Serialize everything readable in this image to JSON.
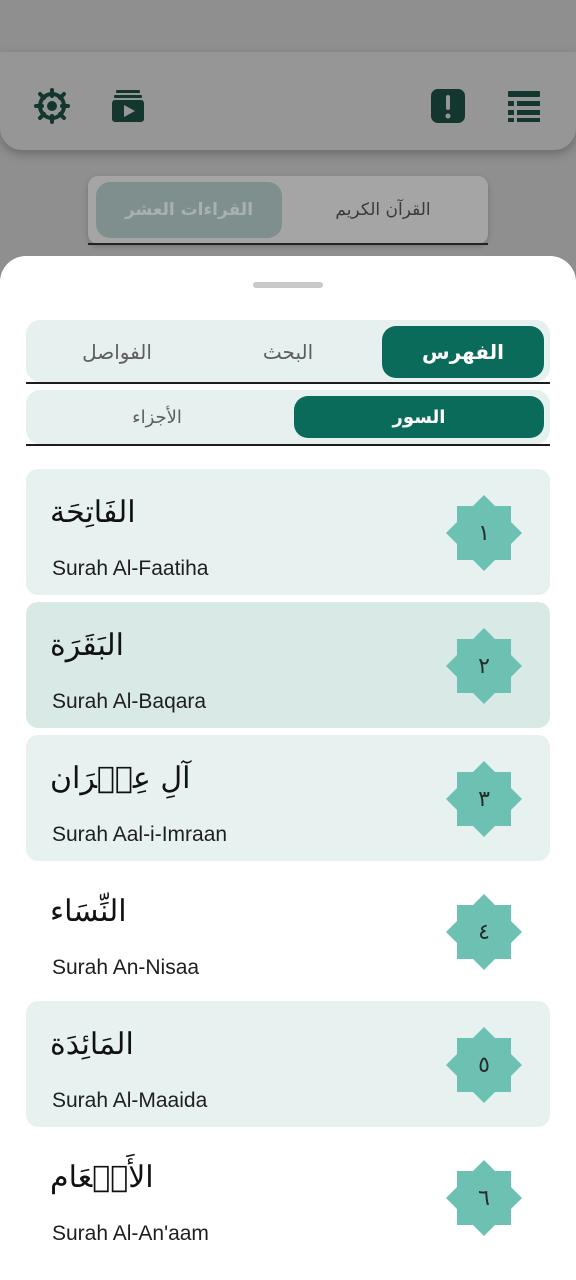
{
  "background": {
    "header_icons": [
      "settings-wheel-icon",
      "video-playlist-icon",
      "alert-icon",
      "menu-list-icon"
    ],
    "tabs": {
      "active": "القراءات العشر",
      "other": "القرآن الكريم"
    }
  },
  "sheet": {
    "main_tabs": [
      {
        "label": "الفهرس",
        "active": true
      },
      {
        "label": "البحث",
        "active": false
      },
      {
        "label": "الفواصل",
        "active": false
      }
    ],
    "sub_tabs": [
      {
        "label": "السور",
        "active": true
      },
      {
        "label": "الأجزاء",
        "active": false
      }
    ],
    "surahs": [
      {
        "number": "١",
        "arabic": "الفَاتِحَة",
        "english": "Surah Al-Faatiha"
      },
      {
        "number": "٢",
        "arabic": "البَقَرَة",
        "english": "Surah Al-Baqara"
      },
      {
        "number": "٣",
        "arabic": "آلِ عِمۡرَان",
        "english": "Surah Aal-i-Imraan"
      },
      {
        "number": "٤",
        "arabic": "النِّسَاء",
        "english": "Surah An-Nisaa"
      },
      {
        "number": "٥",
        "arabic": "المَائِدَة",
        "english": "Surah Al-Maaida"
      },
      {
        "number": "٦",
        "arabic": "الأَنۡعَام",
        "english": "Surah Al-An'aam"
      }
    ]
  },
  "colors": {
    "accent": "#0a6b5a",
    "badge": "#6cc1b3",
    "row_light": "#e7f1f0",
    "row_selected": "#d9e9e6"
  }
}
